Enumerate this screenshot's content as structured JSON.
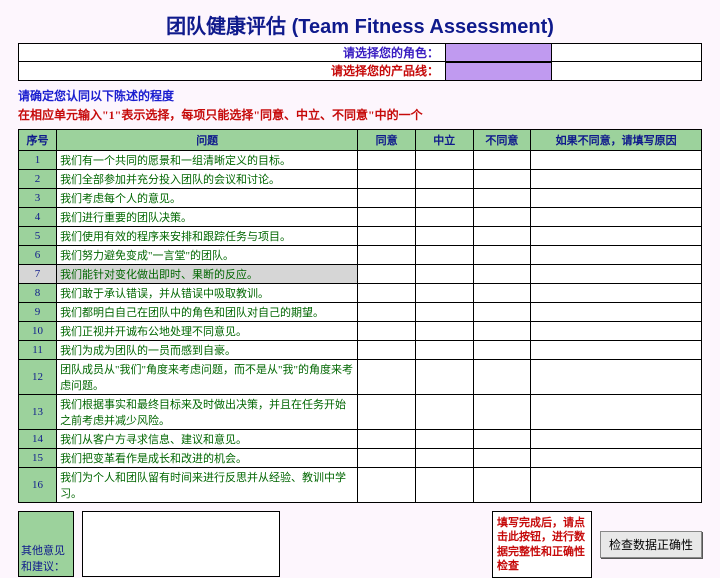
{
  "title": "团队健康评估 (Team Fitness Assessment)",
  "header": {
    "role_label": "请选择您的角色：",
    "product_label": "请选择您的产品线："
  },
  "instructions": {
    "line1": "请确定您认同以下陈述的程度",
    "line2": "在相应单元输入\"1\"表示选择，每项只能选择\"同意、中立、不同意\"中的一个"
  },
  "columns": {
    "num": "序号",
    "question": "问题",
    "agree": "同意",
    "neutral": "中立",
    "disagree": "不同意",
    "reason": "如果不同意，请填写原因"
  },
  "rows": [
    {
      "n": "1",
      "q": "我们有一个共同的愿景和一组清晰定义的目标。"
    },
    {
      "n": "2",
      "q": "我们全部参加并充分投入团队的会议和讨论。"
    },
    {
      "n": "3",
      "q": "我们考虑每个人的意见。"
    },
    {
      "n": "4",
      "q": "我们进行重要的团队决策。"
    },
    {
      "n": "5",
      "q": "我们使用有效的程序来安排和跟踪任务与项目。"
    },
    {
      "n": "6",
      "q": "我们努力避免变成\"一言堂\"的团队。"
    },
    {
      "n": "7",
      "q": "我们能针对变化做出即时、果断的反应。",
      "hl": true
    },
    {
      "n": "8",
      "q": "我们敢于承认错误，并从错误中吸取教训。"
    },
    {
      "n": "9",
      "q": "我们都明白自己在团队中的角色和团队对自己的期望。"
    },
    {
      "n": "10",
      "q": "我们正视并开诚布公地处理不同意见。"
    },
    {
      "n": "11",
      "q": "我们为成为团队的一员而感到自豪。"
    },
    {
      "n": "12",
      "q": "团队成员从\"我们\"角度来考虑问题，而不是从\"我\"的角度来考虑问题。",
      "tall": true
    },
    {
      "n": "13",
      "q": "我们根据事实和最终目标来及时做出决策，并且在任务开始之前考虑并减少风险。",
      "tall": true
    },
    {
      "n": "14",
      "q": "我们从客户方寻求信息、建议和意见。"
    },
    {
      "n": "15",
      "q": "我们把变革看作是成长和改进的机会。"
    },
    {
      "n": "16",
      "q": "我们为个人和团队留有时间来进行反思并从经验、教训中学习。",
      "tall": true
    }
  ],
  "footer": {
    "comments_label": "其他意见和建议：",
    "note": "填写完成后，请点击此按钮，进行数据完整性和正确性检查",
    "button": "检查数据正确性"
  },
  "chart_data": {
    "type": "table",
    "title": "团队健康评估 (Team Fitness Assessment)",
    "columns": [
      "序号",
      "问题",
      "同意",
      "中立",
      "不同意",
      "如果不同意，请填写原因"
    ],
    "rows": [
      [
        "1",
        "我们有一个共同的愿景和一组清晰定义的目标。",
        "",
        "",
        "",
        ""
      ],
      [
        "2",
        "我们全部参加并充分投入团队的会议和讨论。",
        "",
        "",
        "",
        ""
      ],
      [
        "3",
        "我们考虑每个人的意见。",
        "",
        "",
        "",
        ""
      ],
      [
        "4",
        "我们进行重要的团队决策。",
        "",
        "",
        "",
        ""
      ],
      [
        "5",
        "我们使用有效的程序来安排和跟踪任务与项目。",
        "",
        "",
        "",
        ""
      ],
      [
        "6",
        "我们努力避免变成\"一言堂\"的团队。",
        "",
        "",
        "",
        ""
      ],
      [
        "7",
        "我们能针对变化做出即时、果断的反应。",
        "",
        "",
        "",
        ""
      ],
      [
        "8",
        "我们敢于承认错误，并从错误中吸取教训。",
        "",
        "",
        "",
        ""
      ],
      [
        "9",
        "我们都明白自己在团队中的角色和团队对自己的期望。",
        "",
        "",
        "",
        ""
      ],
      [
        "10",
        "我们正视并开诚布公地处理不同意见。",
        "",
        "",
        "",
        ""
      ],
      [
        "11",
        "我们为成为团队的一员而感到自豪。",
        "",
        "",
        "",
        ""
      ],
      [
        "12",
        "团队成员从\"我们\"角度来考虑问题，而不是从\"我\"的角度来考虑问题。",
        "",
        "",
        "",
        ""
      ],
      [
        "13",
        "我们根据事实和最终目标来及时做出决策，并且在任务开始之前考虑并减少风险。",
        "",
        "",
        "",
        ""
      ],
      [
        "14",
        "我们从客户方寻求信息、建议和意见。",
        "",
        "",
        "",
        ""
      ],
      [
        "15",
        "我们把变革看作是成长和改进的机会。",
        "",
        "",
        "",
        ""
      ],
      [
        "16",
        "我们为个人和团队留有时间来进行反思并从经验、教训中学习。",
        "",
        "",
        "",
        ""
      ]
    ]
  }
}
